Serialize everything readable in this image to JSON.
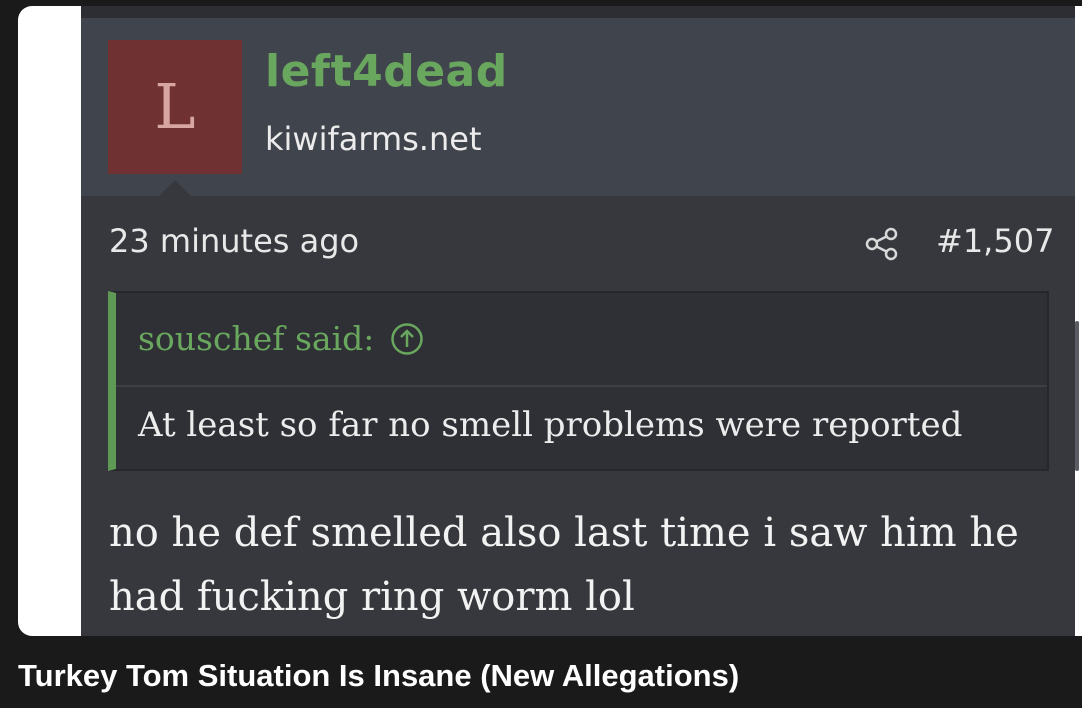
{
  "avatar": {
    "letter": "L"
  },
  "post": {
    "username": "left4dead",
    "site": "kiwifarms.net",
    "timestamp": "23 minutes ago",
    "post_number": "#1,507",
    "body": "no he def smelled also last time i saw him he had fucking ring worm lol"
  },
  "quote": {
    "author": "souschef said:",
    "text": "At least so far no smell problems were reported"
  },
  "video": {
    "title": "Turkey Tom Situation Is Insane (New Allegations)"
  },
  "icons": {
    "share": "share-icon",
    "quote_jump": "arrow-up-circle-icon"
  },
  "colors": {
    "username": "#6aa75e",
    "avatar_bg": "#6f3131",
    "quote_border": "#5f9a55",
    "post_bg": "#36383e",
    "header_bg": "#40444c"
  }
}
